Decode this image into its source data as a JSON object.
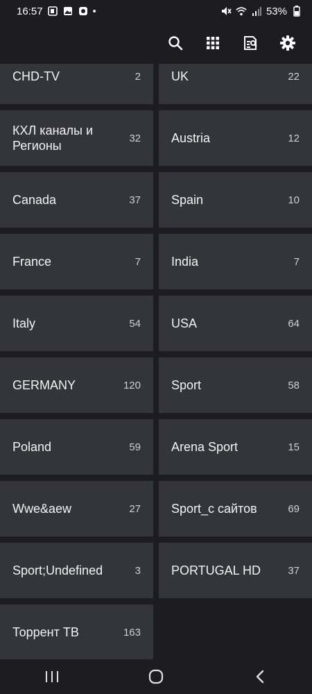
{
  "status_bar": {
    "time": "16:57",
    "dot": "•",
    "battery": "53%",
    "left_icons": [
      "notification-icon",
      "gallery-icon",
      "app-icon"
    ],
    "right_icons": [
      "mute-icon",
      "wifi-icon",
      "signal-icon",
      "battery-icon"
    ]
  },
  "toolbar": {
    "icons": [
      "search-icon",
      "grid-icon",
      "playlist-icon",
      "settings-icon"
    ]
  },
  "groups": [
    {
      "name": "CHD-TV",
      "count": "2"
    },
    {
      "name": "UK",
      "count": "22"
    },
    {
      "name": "КХЛ каналы и Регионы",
      "count": "32"
    },
    {
      "name": "Austria",
      "count": "12"
    },
    {
      "name": "Canada",
      "count": "37"
    },
    {
      "name": "Spain",
      "count": "10"
    },
    {
      "name": "France",
      "count": "7"
    },
    {
      "name": "India",
      "count": "7"
    },
    {
      "name": "Italy",
      "count": "54"
    },
    {
      "name": "USA",
      "count": "64"
    },
    {
      "name": "GERMANY",
      "count": "120"
    },
    {
      "name": "Sport",
      "count": "58"
    },
    {
      "name": "Poland",
      "count": "59"
    },
    {
      "name": "Arena Sport",
      "count": "15"
    },
    {
      "name": "Wwe&aew",
      "count": "27"
    },
    {
      "name": "Sport_с сайтов",
      "count": "69"
    },
    {
      "name": "Sport;Undefined",
      "count": "3"
    },
    {
      "name": "PORTUGAL HD",
      "count": "37"
    },
    {
      "name": "Торрент ТВ",
      "count": "163"
    }
  ],
  "nav_bar": {
    "icons": [
      "recent-apps-icon",
      "home-icon",
      "back-icon"
    ]
  }
}
